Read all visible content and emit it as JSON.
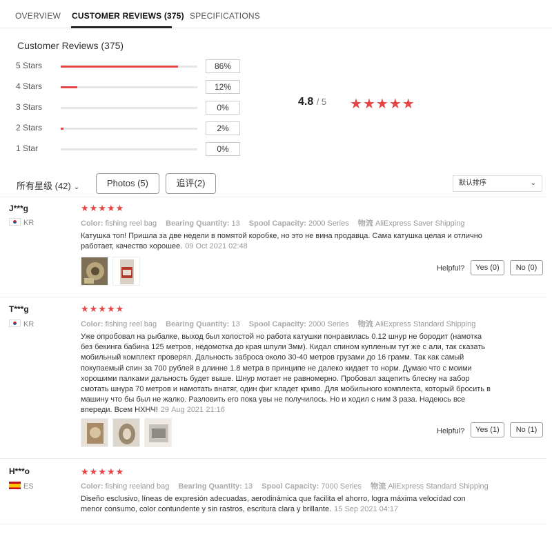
{
  "tabs": [
    "OVERVIEW",
    "CUSTOMER REVIEWS (375)",
    "SPECIFICATIONS"
  ],
  "summary": {
    "title": "Customer Reviews (375)",
    "rows": [
      {
        "label": "5 Stars",
        "pct": "86%",
        "fraction": 0.86
      },
      {
        "label": "4 Stars",
        "pct": "12%",
        "fraction": 0.12
      },
      {
        "label": "3 Stars",
        "pct": "0%",
        "fraction": 0.0
      },
      {
        "label": "2 Stars",
        "pct": "2%",
        "fraction": 0.02
      },
      {
        "label": "1 Star",
        "pct": "0%",
        "fraction": 0.0
      }
    ],
    "rating": "4.8",
    "rating_max": "/ 5",
    "rating_stars": 5
  },
  "filters": {
    "all": "所有星级 (42)",
    "photos": "Photos (5)",
    "additional": "追评(2)",
    "sort": "默认排序"
  },
  "reviews": [
    {
      "user": "J***g",
      "country": "KR",
      "stars": "★★★★★",
      "color_label": "Color:",
      "color": "fishing reel bag",
      "bearing_label": "Bearing Quantity:",
      "bearing": "13",
      "spool_label": "Spool Capacity:",
      "spool": "2000 Series",
      "ship_label": "物流",
      "ship": "AliExpress Saver Shipping",
      "text": "Катушка топ! Пришла за две недели в помятой коробке, но это не вина продавца. Сама катушка целая и отлично работает, качество хорошее.",
      "date": "09 Oct 2021 02:48",
      "helpful": "Helpful?",
      "yes": "Yes (0)",
      "no": "No (0)"
    },
    {
      "user": "T***g",
      "country": "KR",
      "stars": "★★★★★",
      "color_label": "Color:",
      "color": "fishing reel bag",
      "bearing_label": "Bearing Quantity:",
      "bearing": "13",
      "spool_label": "Spool Capacity:",
      "spool": "2000 Series",
      "ship_label": "物流",
      "ship": "AliExpress Standard Shipping",
      "text": "Уже опробовал на рыбалке, выход был холостой но работа катушки понравилась 0.12 шнур не бородит (намотка без бекинга бабина 125 метров, недомотка до края шпули 3мм). Кидал спином купленым тут же с али, так сказать мобильный комплект проверял. Дальность заброса около 30-40 метров грузами до 16 грамм. Так как самый покупаемый спин за 700 рублей в длинне 1.8 метра в принципе не далеко кидает то норм. Думаю что с моими хорошими палками дальность будет выше. Шнур мотает не равномерно. Пробовал зацепить блесну на забор смотать шнура 70 метров и намотать внатяг, один фиг кладет криво. Для мобильного комплекта, который бросить в машину что бы был не жалко. Разловить его пока увы не получилось. Но и ходил с ним 3 раза. Надеюсь все впереди. Всем НХНЧ!",
      "date": "29 Aug 2021 21:16",
      "helpful": "Helpful?",
      "yes": "Yes (1)",
      "no": "No (1)"
    },
    {
      "user": "H***o",
      "country": "ES",
      "stars": "★★★★★",
      "color_label": "Color:",
      "color": "fishing reeland bag",
      "bearing_label": "Bearing Quantity:",
      "bearing": "13",
      "spool_label": "Spool Capacity:",
      "spool": "7000 Series",
      "ship_label": "物流",
      "ship": "AliExpress Standard Shipping",
      "text": "Diseño esclusivo, líneas de expresión adecuadas, aerodinámica que facilita el ahorro, logra máxima velocidad con menor consumo, color contundente y sin rastros, escritura clara y brillante.",
      "date": "15 Sep 2021 04:17"
    }
  ],
  "colors": {
    "accent": "#e64545",
    "bar_track": "#e6e6e6"
  }
}
